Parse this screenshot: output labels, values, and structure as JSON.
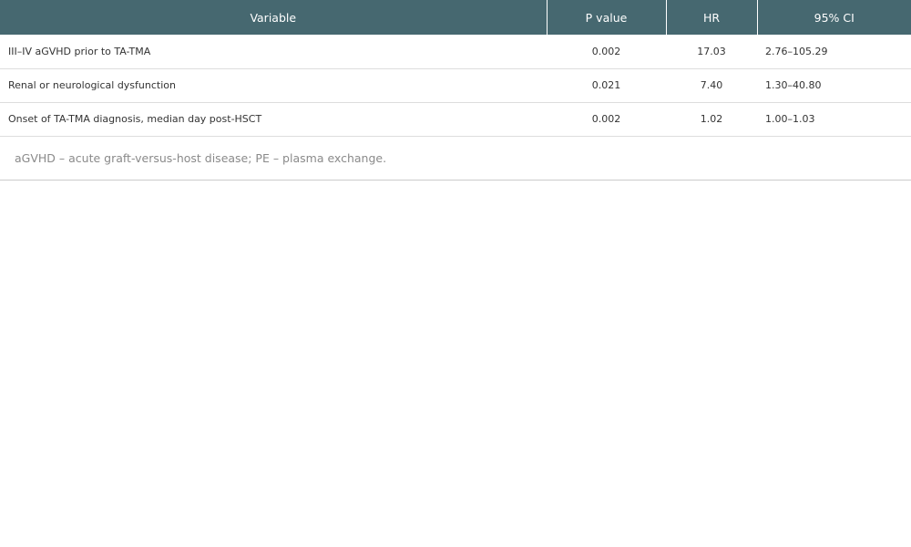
{
  "table": {
    "headers": [
      "Variable",
      "P value",
      "HR",
      "95% CI"
    ],
    "rows": [
      {
        "variable": "III–IV aGVHD prior to TA-TMA",
        "p_value": "0.002",
        "hr": "17.03",
        "ci": "2.76–105.29"
      },
      {
        "variable": "Renal or neurological dysfunction",
        "p_value": "0.021",
        "hr": "7.40",
        "ci": "1.30–40.80"
      },
      {
        "variable": "Onset of TA-TMA diagnosis, median day post-HSCT",
        "p_value": "0.002",
        "hr": "1.02",
        "ci": "1.00–1.03"
      }
    ],
    "footnote": "aGVHD – acute graft-versus-host disease; PE – plasma exchange."
  },
  "colors": {
    "header_bg": "#466870",
    "header_text": "#ffffff",
    "footnote_text": "#8a8a8a"
  }
}
